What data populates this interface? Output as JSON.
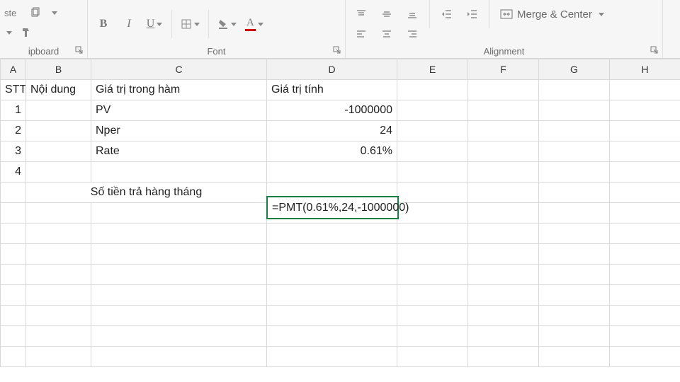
{
  "ribbon": {
    "clipboard": {
      "label": "ipboard",
      "paste_fragment": "ste"
    },
    "font": {
      "label": "Font",
      "bold": "B",
      "italic": "I",
      "underline": "U",
      "fontcolor": "A"
    },
    "alignment": {
      "label": "Alignment",
      "merge": "Merge & Center"
    }
  },
  "columns": [
    "A",
    "B",
    "C",
    "D",
    "E",
    "F",
    "G",
    "H"
  ],
  "cells": {
    "r1": {
      "A": "STT",
      "B": "Nội dung",
      "C": "Giá trị trong hàm",
      "D": "Giá trị tính"
    },
    "r2": {
      "A": "1",
      "C": "PV",
      "D": "-1000000"
    },
    "r3": {
      "A": "2",
      "C": "Nper",
      "D": "24"
    },
    "r4": {
      "A": "3",
      "C": "Rate",
      "D": "0.61%"
    },
    "r5": {
      "A": "4"
    },
    "r6": {
      "B_merged": "Số tiền trả hàng tháng"
    }
  },
  "active_formula": "=PMT(0.61%,24,-1000000)"
}
